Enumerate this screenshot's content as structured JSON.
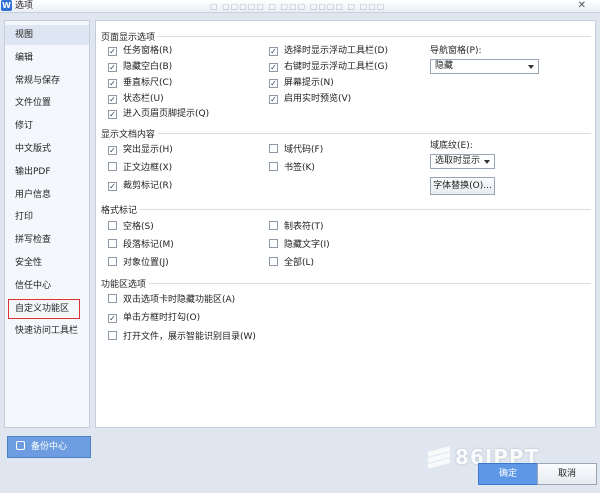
{
  "window": {
    "title": "选项",
    "app_icon": "W",
    "blurred_tabs": "▢ ▢▢▢▢▢ ▢ ▢▢▢ ▢▢▢▢ ▢ ▢▢▢",
    "close_glyph": "✕"
  },
  "sidebar": {
    "items": [
      {
        "label": "视图"
      },
      {
        "label": "编辑"
      },
      {
        "label": "常规与保存"
      },
      {
        "label": "文件位置"
      },
      {
        "label": "修订"
      },
      {
        "label": "中文版式"
      },
      {
        "label": "输出PDF"
      },
      {
        "label": "用户信息"
      },
      {
        "label": "打印"
      },
      {
        "label": "拼写检查"
      },
      {
        "label": "安全性"
      },
      {
        "label": "信任中心"
      },
      {
        "label": "自定义功能区"
      },
      {
        "label": "快速访问工具栏"
      }
    ],
    "active_index": 0,
    "highlighted_index": 12
  },
  "backup": {
    "label": "备份中心"
  },
  "groups": {
    "page_display": {
      "title": "页面显示选项",
      "col1": [
        {
          "label": "任务窗格(R)",
          "checked": true
        },
        {
          "label": "隐藏空白(B)",
          "checked": true
        },
        {
          "label": "垂直标尺(C)",
          "checked": true
        },
        {
          "label": "状态栏(U)",
          "checked": true
        },
        {
          "label": "进入页眉页脚提示(Q)",
          "checked": true
        }
      ],
      "col2": [
        {
          "label": "选择时显示浮动工具栏(D)",
          "checked": true
        },
        {
          "label": "右键时显示浮动工具栏(G)",
          "checked": true
        },
        {
          "label": "屏幕提示(N)",
          "checked": true
        },
        {
          "label": "启用实时预览(V)",
          "checked": true
        }
      ],
      "nav_pane_label": "导航窗格(P):",
      "nav_pane_value": "隐藏"
    },
    "doc_content": {
      "title": "显示文档内容",
      "col1": [
        {
          "label": "突出显示(H)",
          "checked": true
        },
        {
          "label": "正文边框(X)",
          "checked": false
        },
        {
          "label": "裁剪标记(R)",
          "checked": true
        }
      ],
      "col2": [
        {
          "label": "域代码(F)",
          "checked": false
        },
        {
          "label": "书签(K)",
          "checked": false
        }
      ],
      "field_shading_label": "域底纹(E):",
      "field_shading_value": "选取时显示",
      "font_replace_label": "字体替换(O)..."
    },
    "format_marks": {
      "title": "格式标记",
      "col1": [
        {
          "label": "空格(S)",
          "checked": false
        },
        {
          "label": "段落标记(M)",
          "checked": false
        },
        {
          "label": "对象位置(J)",
          "checked": false
        }
      ],
      "col2": [
        {
          "label": "制表符(T)",
          "checked": false
        },
        {
          "label": "隐藏文字(I)",
          "checked": false
        },
        {
          "label": "全部(L)",
          "checked": false
        }
      ]
    },
    "ribbon": {
      "title": "功能区选项",
      "items": [
        {
          "label": "双击选项卡时隐藏功能区(A)",
          "checked": false
        },
        {
          "label": "单击方框时打勾(O)",
          "checked": true
        },
        {
          "label": "打开文件，展示智能识别目录(W)",
          "checked": false
        }
      ]
    }
  },
  "footer": {
    "ok_label": "确定",
    "cancel_label": "取消"
  },
  "watermark": {
    "text": "86IPPT"
  },
  "colors": {
    "accent": "#5d97e6",
    "highlight_border": "#dd3333"
  }
}
